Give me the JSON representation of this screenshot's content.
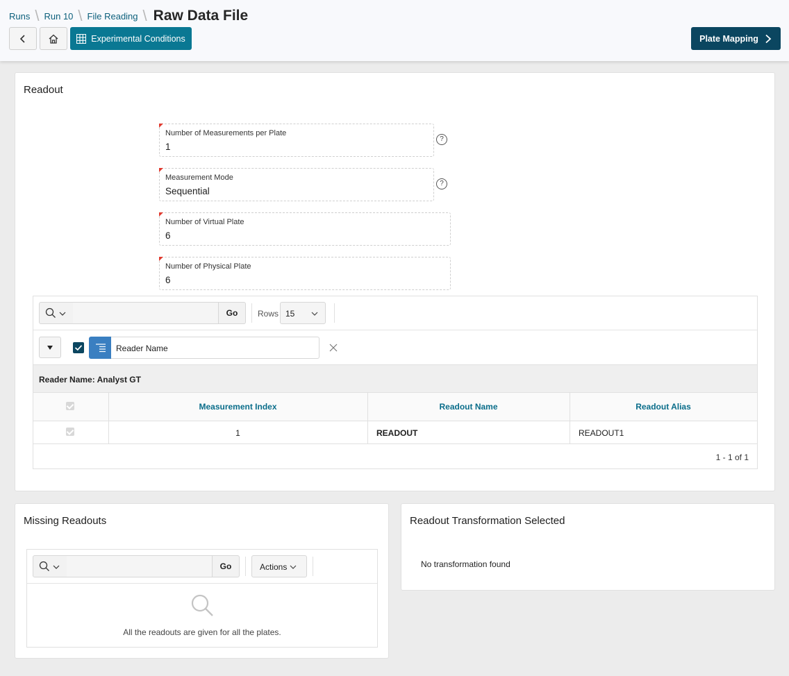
{
  "breadcrumb": {
    "items": [
      "Runs",
      "Run 10",
      "File Reading"
    ],
    "current": "Raw Data File"
  },
  "toolbar": {
    "back_icon": "chevron-left-icon",
    "home_icon": "home-icon",
    "experimental_conditions_label": "Experimental Conditions",
    "plate_mapping_label": "Plate Mapping"
  },
  "readout": {
    "title": "Readout",
    "fields": [
      {
        "label": "Number of Measurements per Plate",
        "value": "1",
        "help": "?"
      },
      {
        "label": "Measurement Mode",
        "value": "Sequential",
        "help": "?"
      },
      {
        "label": "Number of Virtual Plate",
        "value": "6"
      },
      {
        "label": "Number of Physical Plate",
        "value": "6"
      }
    ],
    "report": {
      "go_label": "Go",
      "rows_label": "Rows",
      "rows_value": "15",
      "filter_label": "Reader Name",
      "group_header": "Reader Name: Analyst GT",
      "columns": [
        "Measurement Index",
        "Readout Name",
        "Readout Alias"
      ],
      "rows": [
        {
          "index": "1",
          "name": "READOUT",
          "alias": "READOUT1"
        }
      ],
      "pagination": "1 - 1 of 1"
    }
  },
  "missing": {
    "title": "Missing Readouts",
    "go_label": "Go",
    "actions_label": "Actions",
    "empty_message": "All the readouts are given for all the plates."
  },
  "transformation": {
    "title": "Readout Transformation Selected",
    "empty_message": "No transformation found"
  },
  "colors": {
    "accent_teal": "#0a7893",
    "dark_button": "#0b4660",
    "link": "#0b5f7b"
  }
}
